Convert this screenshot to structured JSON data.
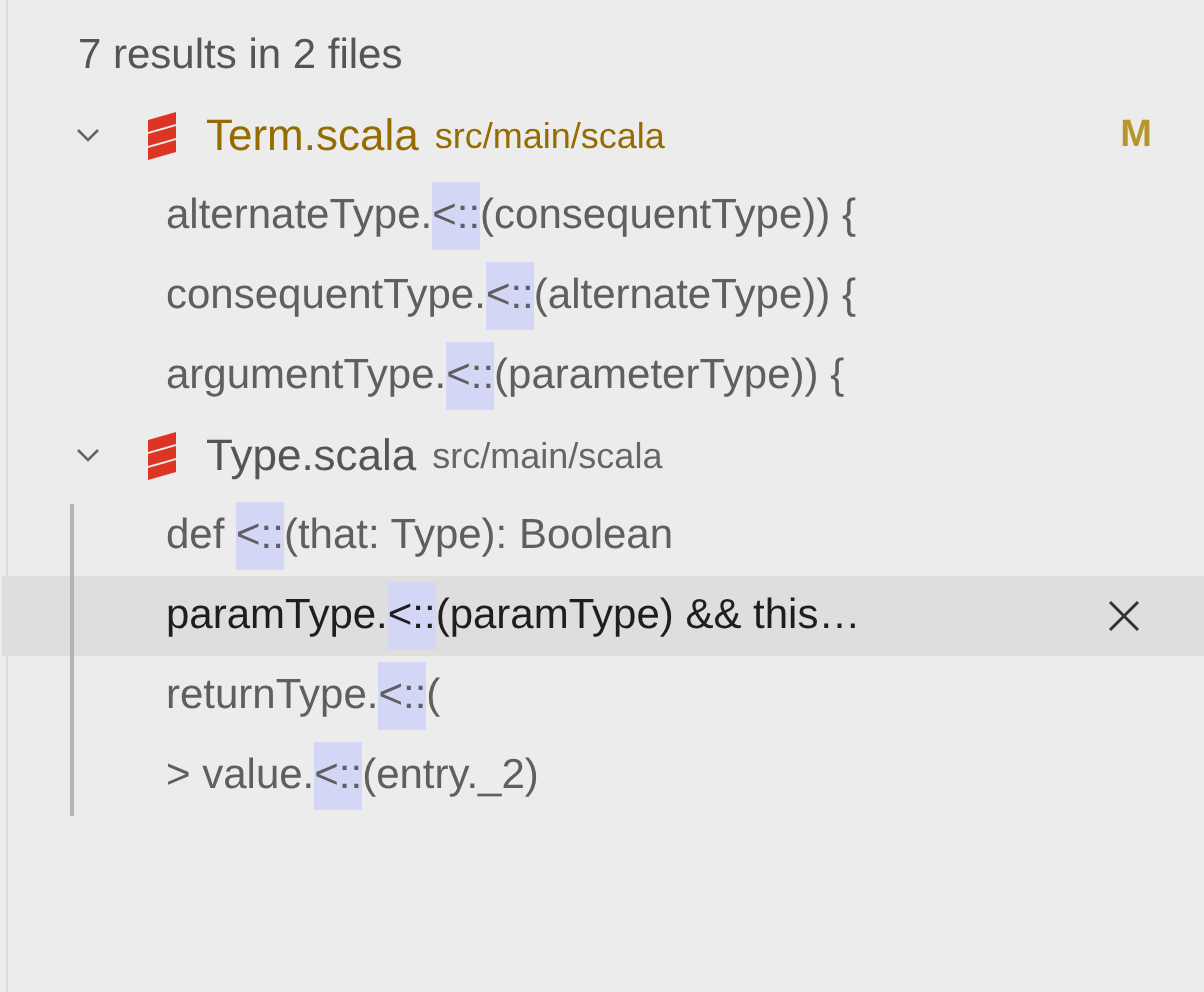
{
  "summary": "7 results in 2 files",
  "files": [
    {
      "name": "Term.scala",
      "path": "src/main/scala",
      "expanded": true,
      "badge": "M",
      "matches": [
        {
          "before": "alternateType.",
          "match": "<::",
          "after": "(consequentType)) {",
          "selected": false
        },
        {
          "before": "consequentType.",
          "match": "<::",
          "after": "(alternateType)) {",
          "selected": false
        },
        {
          "before": "argumentType.",
          "match": "<::",
          "after": "(parameterType)) {",
          "selected": false
        }
      ]
    },
    {
      "name": "Type.scala",
      "path": "src/main/scala",
      "expanded": true,
      "matches": [
        {
          "before": "def ",
          "match": "<::",
          "after": "(that: Type): Boolean",
          "selected": false
        },
        {
          "before": "paramType.",
          "match": "<::",
          "after": "(paramType) && this…",
          "selected": true
        },
        {
          "before": "returnType.",
          "match": "<::",
          "after": "(",
          "selected": false
        },
        {
          "before": "> value.",
          "match": "<::",
          "after": "(entry._2)",
          "selected": false
        }
      ]
    }
  ]
}
